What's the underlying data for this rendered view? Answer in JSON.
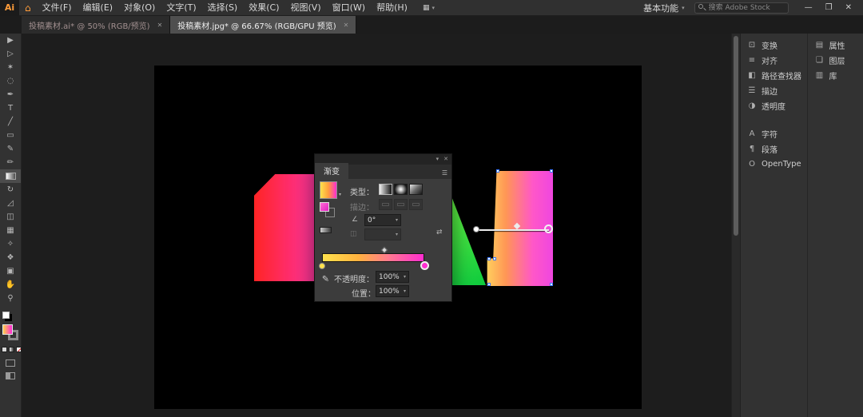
{
  "app": {
    "logo": "Ai",
    "home_icon": "⌂",
    "menus": [
      "文件(F)",
      "编辑(E)",
      "对象(O)",
      "文字(T)",
      "选择(S)",
      "效果(C)",
      "视图(V)",
      "窗口(W)",
      "帮助(H)"
    ],
    "arrange_icon": "▦",
    "caret": "▾",
    "workspace": "基本功能",
    "search_placeholder": "搜索 Adobe Stock",
    "window": {
      "minimize": "—",
      "restore": "❐",
      "close": "✕"
    }
  },
  "tabs": [
    {
      "label": "投稿素材.ai* @ 50% (RGB/预览)",
      "close": "✕"
    },
    {
      "label": "投稿素材.jpg* @ 66.67% (RGB/GPU 预览)",
      "close": "✕"
    }
  ],
  "toolbar": {
    "tools": [
      {
        "name": "selection",
        "glyph": "▶"
      },
      {
        "name": "direct-selection",
        "glyph": "▷"
      },
      {
        "name": "magic-wand",
        "glyph": "✶"
      },
      {
        "name": "lasso",
        "glyph": "◌"
      },
      {
        "name": "pen",
        "glyph": "✒"
      },
      {
        "name": "type",
        "glyph": "T"
      },
      {
        "name": "line-segment",
        "glyph": "╱"
      },
      {
        "name": "rectangle",
        "glyph": "▭"
      },
      {
        "name": "paintbrush",
        "glyph": "✎"
      },
      {
        "name": "pencil",
        "glyph": "✏"
      },
      {
        "name": "gradient",
        "glyph": ""
      },
      {
        "name": "rotate",
        "glyph": "↻"
      },
      {
        "name": "scale",
        "glyph": "◿"
      },
      {
        "name": "shape-builder",
        "glyph": "◫"
      },
      {
        "name": "mesh",
        "glyph": "▦"
      },
      {
        "name": "eyedropper",
        "glyph": "✧"
      },
      {
        "name": "blend",
        "glyph": "❖"
      },
      {
        "name": "artboard",
        "glyph": "▣"
      },
      {
        "name": "hand",
        "glyph": "✋"
      },
      {
        "name": "zoom",
        "glyph": "⚲"
      }
    ]
  },
  "gradient_panel": {
    "title": "渐变",
    "collapse_icon": "▾",
    "close_icon": "✕",
    "menu_icon": "☰",
    "type_label": "类型：",
    "stroke_label": "描边：",
    "angle_icon": "∠",
    "angle_value": "0°",
    "aspect_icon": "◫",
    "reverse_icon": "⇄",
    "opacity_label": "不透明度：",
    "opacity_value": "100%",
    "position_label": "位置：",
    "position_value": "100%",
    "gradient": {
      "stops": [
        {
          "color": "#ffe24d",
          "position": "0%"
        },
        {
          "color": "#ff2dd0",
          "position": "100%"
        }
      ],
      "midpoint": "50%",
      "selected_stop": "end"
    }
  },
  "artwork": {
    "left_shape": {
      "gradient": [
        "#ff2424",
        "#ff39a8"
      ]
    },
    "triangle": {
      "gradient": [
        "#6bf542",
        "#0ecb3e"
      ]
    },
    "right_shape": {
      "gradient": [
        "#ffd25e",
        "#ef46e0"
      ]
    },
    "artboard_color": "#000000"
  },
  "dock": {
    "groupA": [
      {
        "icon": "⊡",
        "label": "变换"
      },
      {
        "icon": "≡",
        "label": "对齐"
      },
      {
        "icon": "◧",
        "label": "路径查找器"
      },
      {
        "icon": "☰",
        "label": "描边"
      },
      {
        "icon": "◑",
        "label": "透明度"
      }
    ],
    "groupB": [
      {
        "icon": "A",
        "label": "字符"
      },
      {
        "icon": "¶",
        "label": "段落"
      },
      {
        "icon": "O",
        "label": "OpenType"
      }
    ],
    "side": [
      {
        "icon": "▤",
        "label": "属性"
      },
      {
        "icon": "❏",
        "label": "图层"
      },
      {
        "icon": "▥",
        "label": "库"
      }
    ]
  }
}
